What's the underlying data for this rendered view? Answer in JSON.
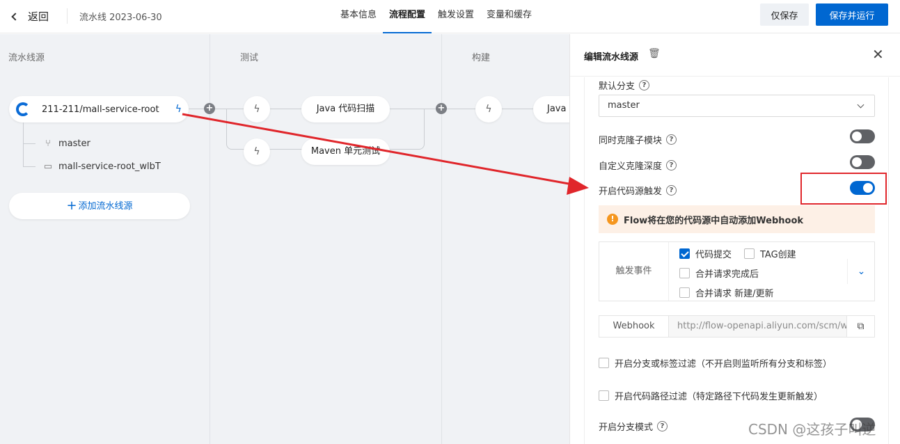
{
  "header": {
    "back_label": "返回",
    "pipeline_name": "流水线 2023-06-30",
    "tabs": [
      {
        "label": "基本信息",
        "active": false
      },
      {
        "label": "流程配置",
        "active": true
      },
      {
        "label": "触发设置",
        "active": false
      },
      {
        "label": "变量和缓存",
        "active": false
      }
    ],
    "save_label": "仅保存",
    "save_run_label": "保存并运行"
  },
  "canvas": {
    "columns": [
      "流水线源",
      "测试",
      "构建"
    ],
    "source": {
      "name": "211-211/mall-service-root",
      "branch": "master",
      "directory": "mall-service-root_wlbT"
    },
    "add_source_label": "添加流水线源",
    "test_jobs": [
      "Java 代码扫描",
      "Maven 单元测试"
    ],
    "build_jobs": [
      "Java"
    ]
  },
  "panel": {
    "title": "编辑流水线源",
    "default_branch_label": "默认分支",
    "default_branch_value": "master",
    "clone_submodules_label": "同时克隆子模块",
    "clone_submodules_on": false,
    "custom_depth_label": "自定义克隆深度",
    "custom_depth_on": false,
    "trigger_label": "开启代码源触发",
    "trigger_on": true,
    "warning": "Flow将在您的代码源中自动添加Webhook",
    "events_label": "触发事件",
    "events": [
      {
        "label": "代码提交",
        "checked": true
      },
      {
        "label": "TAG创建",
        "checked": false
      },
      {
        "label": "合并请求完成后",
        "checked": false
      },
      {
        "label": "合并请求 新建/更新",
        "checked": false
      }
    ],
    "webhook_label": "Webhook",
    "webhook_url": "http://flow-openapi.aliyun.com/scm/webhook",
    "branch_filter_label": "开启分支或标签过滤（不开启则监听所有分支和标签）",
    "path_filter_label": "开启代码路径过滤（特定路径下代码发生更新触发）",
    "branch_mode_label": "开启分支模式",
    "branch_mode_on": false
  },
  "watermark": "CSDN @这孩子叫逆",
  "colors": {
    "primary": "#0067d1",
    "annotation": "#e0262b",
    "warning": "#f5961e"
  }
}
